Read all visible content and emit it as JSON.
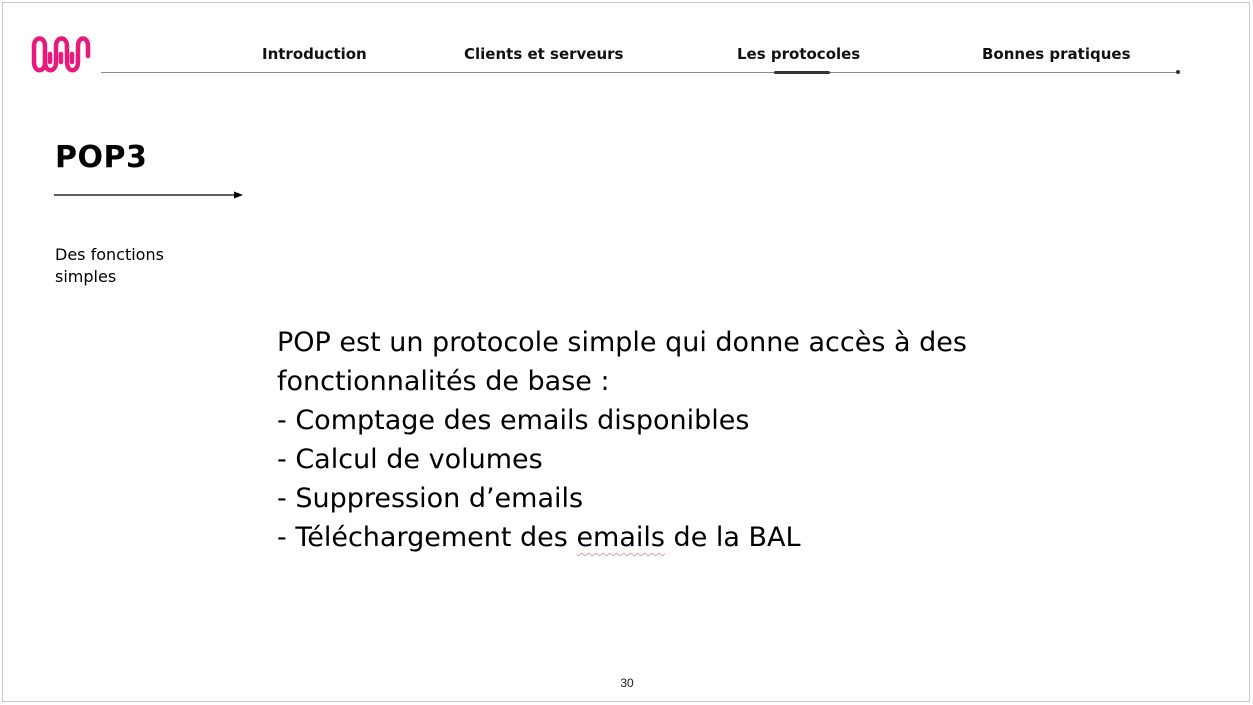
{
  "nav": {
    "items": [
      {
        "label": "Introduction",
        "active": false
      },
      {
        "label": "Clients et serveurs",
        "active": false
      },
      {
        "label": "Les protocoles",
        "active": true
      },
      {
        "label": "Bonnes pratiques",
        "active": false
      }
    ]
  },
  "logo": {
    "icon": "wavy-w-logo",
    "color": "#e8197a"
  },
  "slide": {
    "title": "POP3",
    "subtitle": "Des fonctions simples",
    "body": {
      "intro_line1": "POP est un protocole simple qui donne accès à des",
      "intro_line2": "fonctionnalités de base :",
      "bullets": [
        "- Comptage des emails disponibles",
        "- Calcul de volumes",
        "- Suppression d’emails"
      ],
      "last_bullet_prefix": "- Téléchargement des ",
      "last_bullet_flagged": "emails",
      "last_bullet_suffix": " de la BAL"
    },
    "page_number": "30"
  },
  "colors": {
    "accent": "#e8197a",
    "text": "#000000",
    "rule": "#888888"
  }
}
